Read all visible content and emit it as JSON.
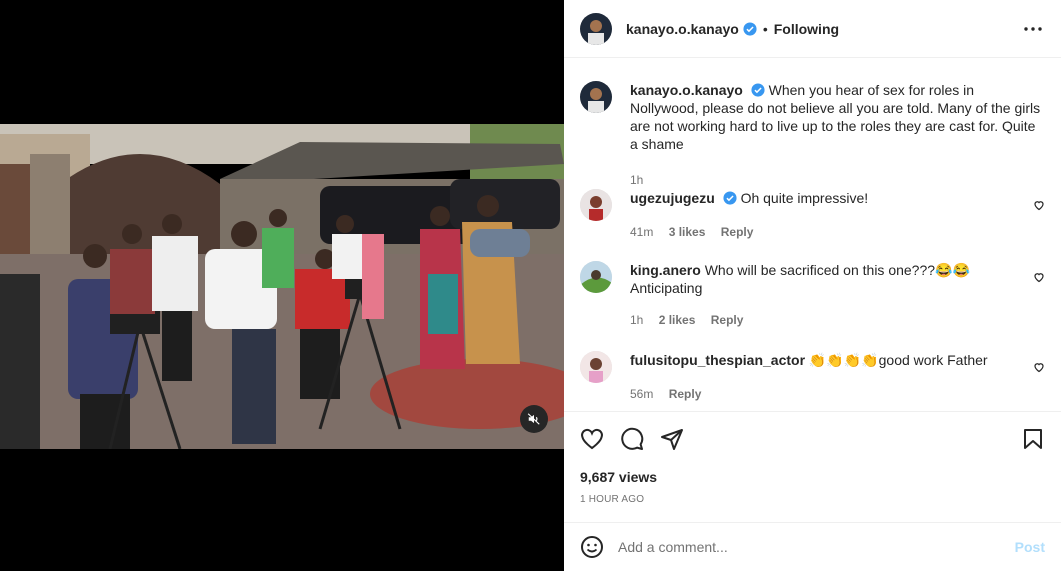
{
  "post": {
    "author": "kanayo.o.kanayo",
    "follow_status": "Following",
    "separator": "•",
    "caption": "When you hear of sex for roles in Nollywood, please do not believe all you are told. Many of the girls are not working hard to live up to the roles they are cast for. Quite a shame",
    "caption_time": "1h",
    "views": "9,687 views",
    "posted": "1 HOUR AGO"
  },
  "comments": [
    {
      "user": "ugezujugezu",
      "verified": true,
      "text": "Oh quite impressive!",
      "time": "41m",
      "likes": "3 likes",
      "reply": "Reply"
    },
    {
      "user": "king.anero",
      "verified": false,
      "text": "Who will be sacrificed on this one???😂😂 Anticipating",
      "time": "1h",
      "likes": "2 likes",
      "reply": "Reply"
    },
    {
      "user": "fulusitopu_thespian_actor",
      "verified": false,
      "text": "👏👏👏👏good work Father",
      "time": "56m",
      "likes": "",
      "reply": "Reply"
    }
  ],
  "composer": {
    "placeholder": "Add a comment...",
    "post_label": "Post"
  },
  "colors": {
    "verified": "#3897f0",
    "post_disabled": "#b2dffc",
    "muted": "#737373"
  },
  "icons": [
    "more-options-icon",
    "heart-icon",
    "comment-icon",
    "share-icon",
    "save-icon",
    "emoji-icon",
    "mute-icon",
    "verified-badge-icon"
  ]
}
